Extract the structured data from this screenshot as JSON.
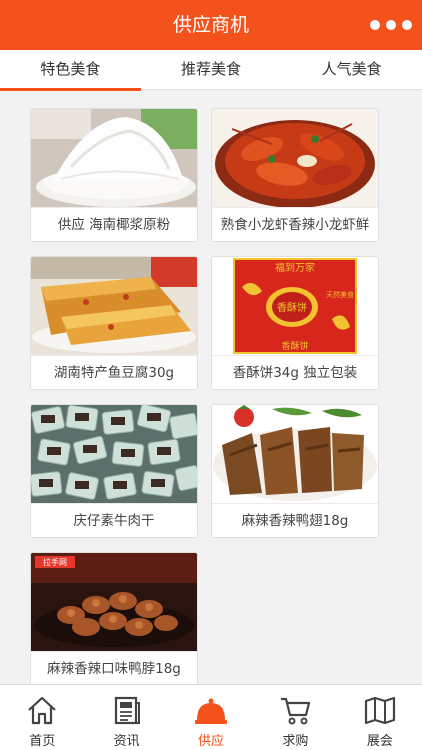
{
  "header": {
    "title": "供应商机"
  },
  "tabs": [
    {
      "label": "特色美食",
      "active": true
    },
    {
      "label": "推荐美食",
      "active": false
    },
    {
      "label": "人气美食",
      "active": false
    }
  ],
  "products": [
    {
      "name": "供应 海南椰浆原粉"
    },
    {
      "name": "熟食小龙虾香辣小龙虾鲜"
    },
    {
      "name": "湖南特产鱼豆腐30g"
    },
    {
      "name": "香酥饼34g 独立包装"
    },
    {
      "name": "庆仔素牛肉干"
    },
    {
      "name": "麻辣香辣鸭翅18g"
    },
    {
      "name": "麻辣香辣口味鸭脖18g"
    }
  ],
  "image_text": {
    "cake_box_top": "福到万家",
    "cake_box_center": "香酥饼",
    "cake_box_side": "天然美食",
    "cake_box_bottom": "香酥饼",
    "duckneck_logo": "拉手网"
  },
  "tabbar": [
    {
      "label": "首页",
      "icon": "home-icon",
      "active": false
    },
    {
      "label": "资讯",
      "icon": "news-icon",
      "active": false
    },
    {
      "label": "供应",
      "icon": "supply-bell-icon",
      "active": true
    },
    {
      "label": "求购",
      "icon": "cart-icon",
      "active": false
    },
    {
      "label": "展会",
      "icon": "map-icon",
      "active": false
    }
  ],
  "colors": {
    "accent": "#f3521d",
    "background": "#f2f2f2"
  }
}
